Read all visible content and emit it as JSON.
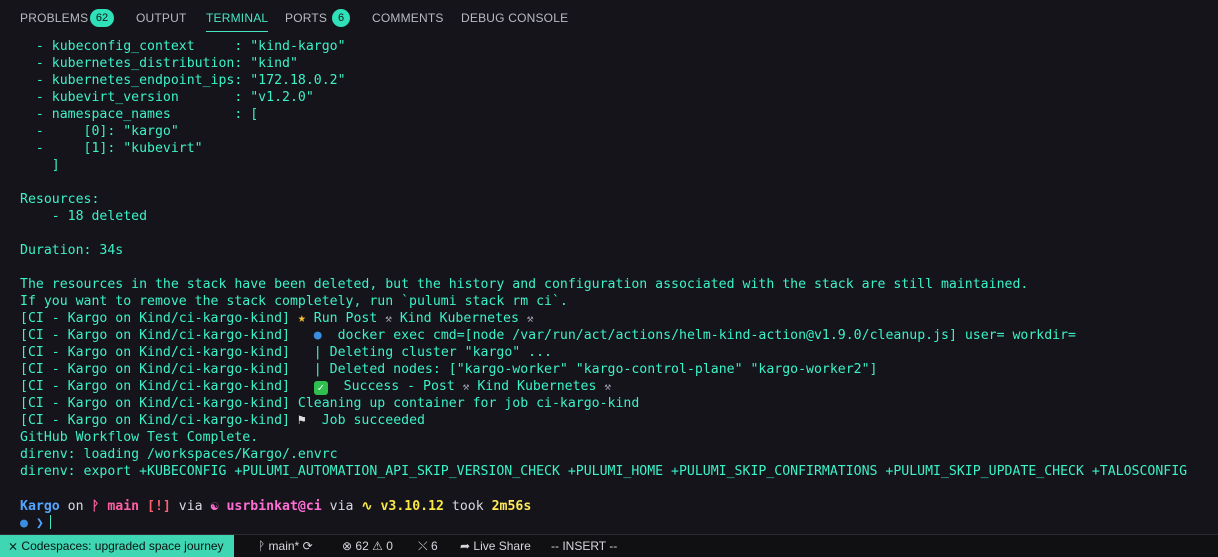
{
  "panel_tabs": [
    {
      "label": "PROBLEMS",
      "badge": "62"
    },
    {
      "label": "OUTPUT"
    },
    {
      "label": "TERMINAL"
    },
    {
      "label": "PORTS",
      "badge": "6"
    },
    {
      "label": "COMMENTS"
    },
    {
      "label": "DEBUG CONSOLE"
    }
  ],
  "terminal": {
    "lines": [
      "  - kubeconfig_context     : \"kind-kargo\"",
      "  - kubernetes_distribution: \"kind\"",
      "  - kubernetes_endpoint_ips: \"172.18.0.2\"",
      "  - kubevirt_version       : \"v1.2.0\"",
      "  - namespace_names        : [",
      "  -     [0]: \"kargo\"",
      "  -     [1]: \"kubevirt\"",
      "    ]",
      "",
      "Resources:",
      "    - 18 deleted",
      "",
      "Duration: 34s",
      "",
      "The resources in the stack have been deleted, but the history and configuration associated with the stack are still maintained.",
      "If you want to remove the stack completely, run `pulumi stack rm ci`."
    ],
    "ci_prefix": "[CI - Kargo on Kind/ci-kargo-kind]",
    "ci_lines": [
      {
        "pre": " ",
        "emoji": "star",
        "text": " Run Post ",
        "h1": true,
        "mid": " Kind Kubernetes ",
        "h2": true
      },
      {
        "pre": "   ",
        "emoji": "whale",
        "text": "  docker exec cmd=[node /var/run/act/actions/helm-kind-action@v1.9.0/cleanup.js] user= workdir="
      },
      {
        "pre": "   ",
        "text": "| Deleting cluster \"kargo\" ..."
      },
      {
        "pre": "   ",
        "text": "| Deleted nodes: [\"kargo-worker\" \"kargo-control-plane\" \"kargo-worker2\"]"
      },
      {
        "pre": "   ",
        "emoji": "check",
        "text": "  Success - Post ",
        "h1": true,
        "mid": " Kind Kubernetes ",
        "h2": true
      },
      {
        "pre": " ",
        "text": "Cleaning up container for job ci-kargo-kind"
      },
      {
        "pre": " ",
        "emoji": "flag",
        "text": "  Job succeeded"
      }
    ],
    "tail_lines": [
      "GitHub Workflow Test Complete.",
      "direnv: loading /workspaces/Kargo/.envrc",
      "direnv: export +KUBECONFIG +PULUMI_AUTOMATION_API_SKIP_VERSION_CHECK +PULUMI_HOME +PULUMI_SKIP_CONFIRMATIONS +PULUMI_SKIP_UPDATE_CHECK +TALOSCONFIG"
    ]
  },
  "prompt": {
    "dir": "Kargo",
    "on": " on ",
    "branch_icon": "ᚹ",
    "branch": " main",
    "status": " [!]",
    "via1": " via ",
    "user": " usrbinkat@ci",
    "via2": " via ",
    "py_version": " v3.10.12",
    "took": " took ",
    "duration": "2m56s",
    "chevron": "❯"
  },
  "statusbar": {
    "remote": "Codespaces: upgraded space journey",
    "branch": "main*",
    "errors": "62",
    "warnings": "0",
    "ports": "6",
    "live_share": "Live Share",
    "mode": "-- INSERT --"
  },
  "colors": {
    "terminal_text": "#3cf2c9",
    "accent": "#46e6c4",
    "background": "#14141a"
  }
}
